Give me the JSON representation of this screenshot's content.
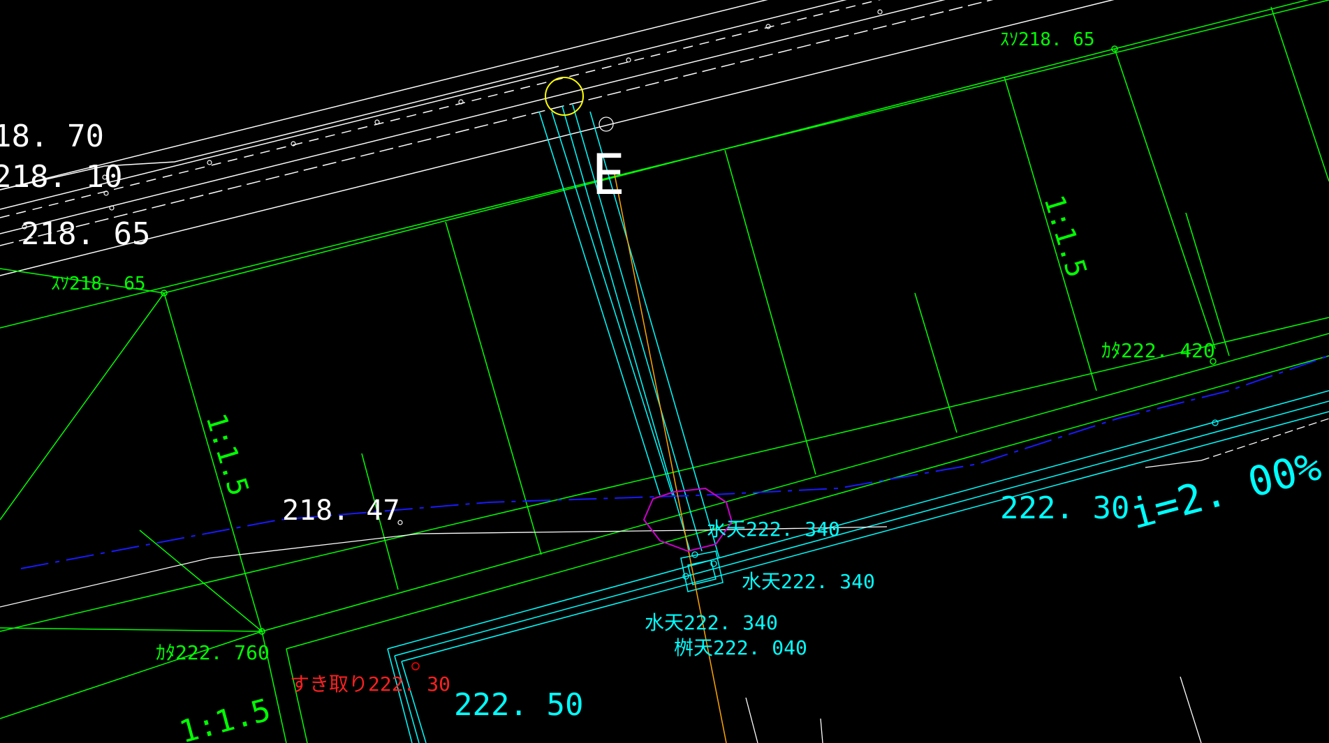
{
  "drawing": {
    "colors": {
      "background": "#000000",
      "green": "#00ff00",
      "cyan": "#00ffff",
      "white": "#ffffff",
      "blue": "#0000ff",
      "magenta": "#cc00cc",
      "yellow": "#ffff00",
      "red": "#ff0000",
      "orange": "#ffa500"
    },
    "elevations_white": [
      "18. 70",
      "218. 10",
      "218. 65",
      "218. 47"
    ],
    "point_label": "E",
    "toe_labels": [
      "ｽｿ218. 65",
      "ｽｿ218. 65"
    ],
    "shoulder_labels": [
      "ｶﾀ222. 420",
      "ｶﾀ222. 760"
    ],
    "slope_ratios": [
      "1:1.5",
      "1:1.5",
      "1:1.5"
    ],
    "cutting_label": "すき取り222. 30",
    "water_levels": [
      "水天222. 340",
      "水天222. 340",
      "水天222. 340"
    ],
    "basin_top": "桝天222. 040",
    "pavement_elevations": [
      "222. 30",
      "222. 50"
    ],
    "gradient": "i=2. 00%"
  }
}
